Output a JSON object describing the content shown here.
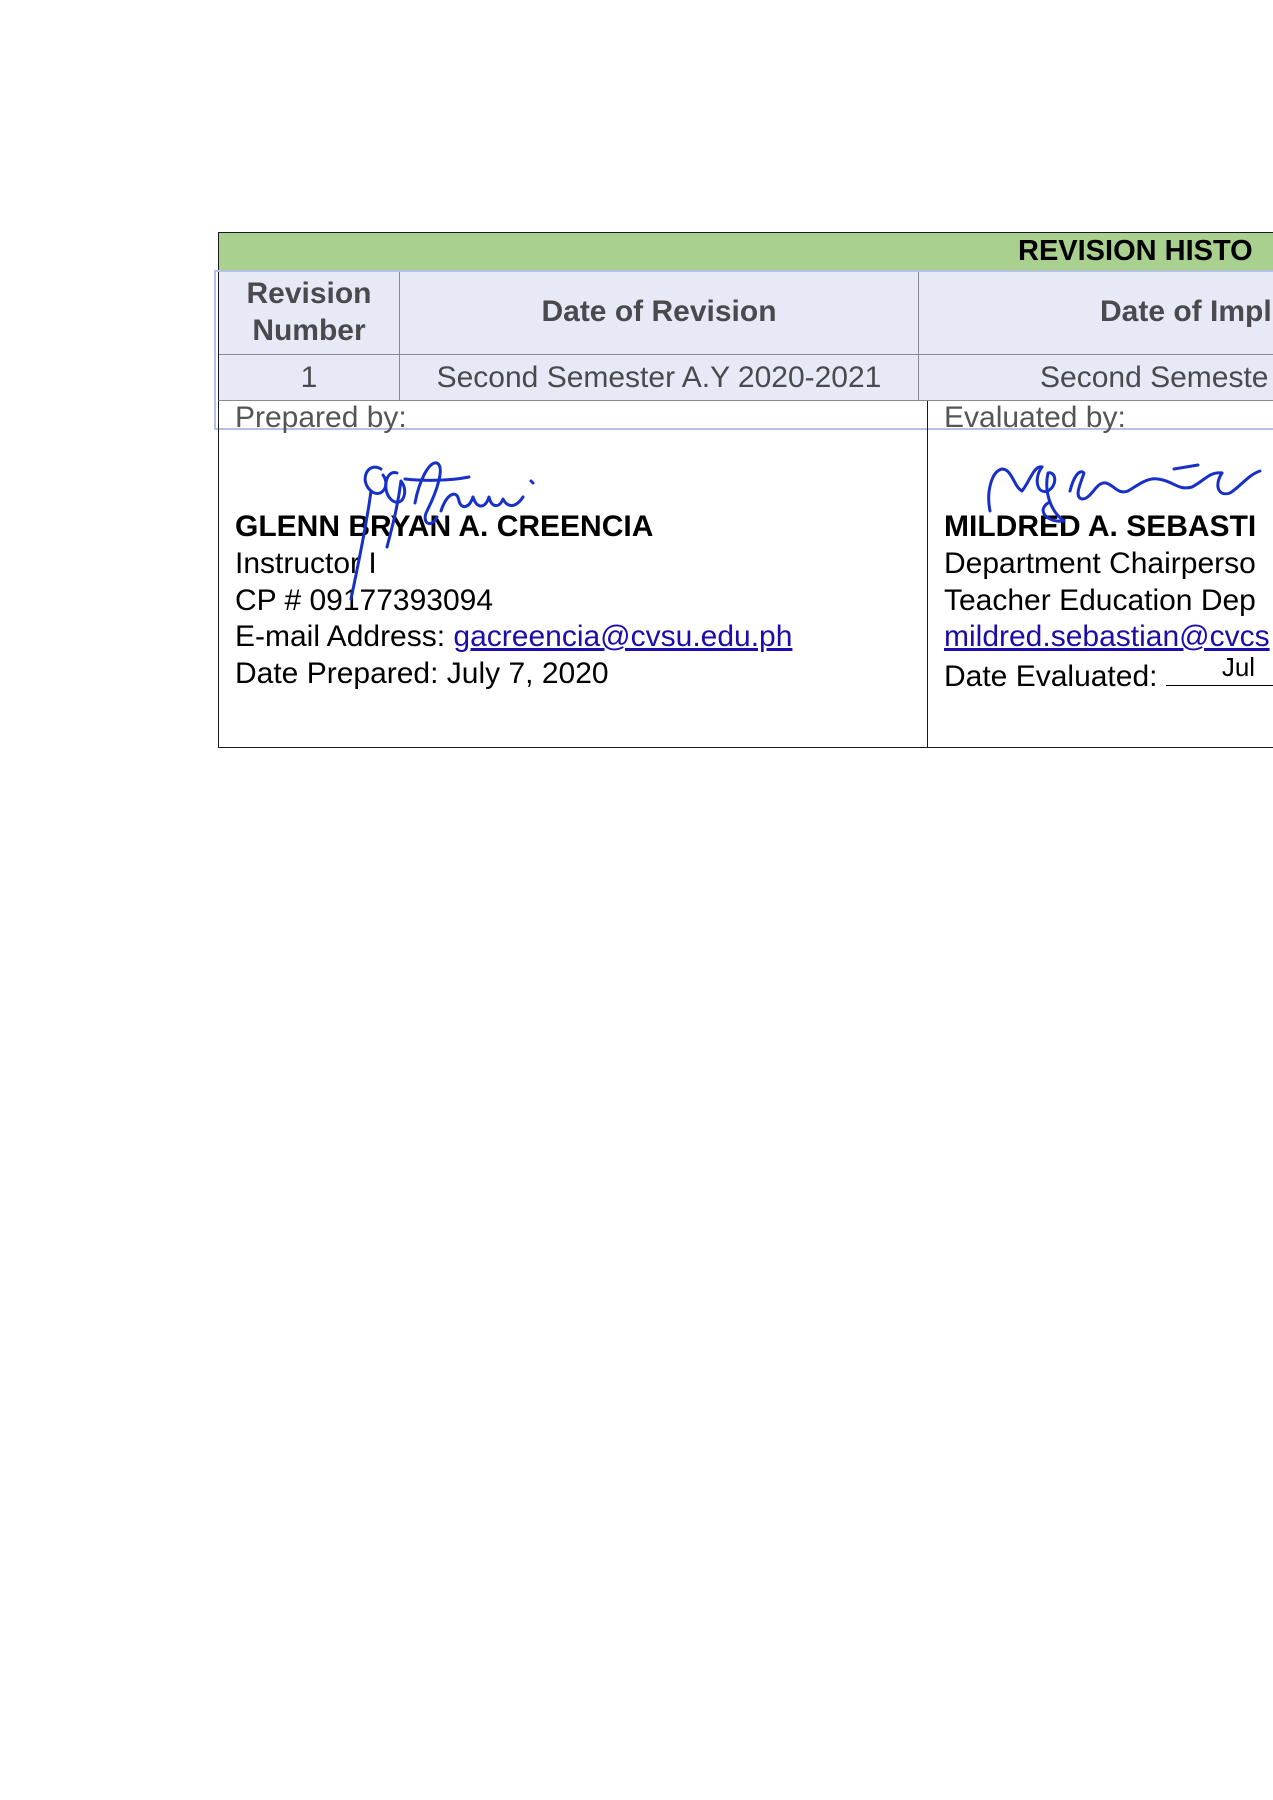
{
  "revision_history": {
    "title": "REVISION HISTO",
    "headers": {
      "revision_number": "Revision Number",
      "date_of_revision": "Date of Revision",
      "date_of_implementation": "Date of Impl"
    },
    "rows": [
      {
        "revision_number": "1",
        "date_of_revision": "Second Semester A.Y 2020-2021",
        "date_of_implementation": "Second Semeste"
      }
    ]
  },
  "prepared": {
    "label": "Prepared by:",
    "name": "GLENN BRYAN A. CREENCIA",
    "position": "Instructor I",
    "phone": "CP # 09177393094",
    "email_label": "E-mail Address: ",
    "email": "gacreencia@cvsu.edu.ph",
    "date": "Date Prepared: July 7, 2020"
  },
  "evaluated": {
    "label": "Evaluated by:",
    "name": "MILDRED A. SEBASTI",
    "position": "Department Chairperso",
    "department": "Teacher Education Dep",
    "email": "mildred.sebastian@cvcs",
    "date_label": "Date Evaluated: ",
    "date_value": "Jul"
  },
  "colors": {
    "title_band": "#a9d08e",
    "header_fill": "#e7eaf6",
    "signature_ink": "#1730c8",
    "link": "#1a0dab"
  }
}
